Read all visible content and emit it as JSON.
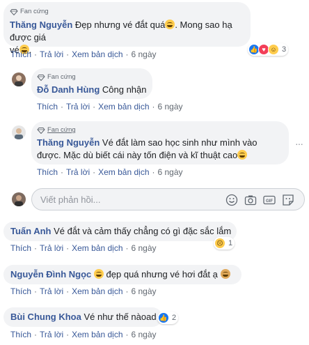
{
  "fan_badge": "Fan cứng",
  "actions": {
    "like": "Thích",
    "reply": "Trả lời",
    "translate": "Xem bản dịch",
    "time": "6 ngày",
    "sep": "·"
  },
  "comment1": {
    "name": "Thăng Nguyễn",
    "text_a": "Đẹp nhưng vé đắt quá",
    "text_b": ". Mong sao hạ được giá",
    "text_c": "vé",
    "text_d": ".",
    "reaction_count": "3"
  },
  "reply1": {
    "name": "Đỗ Danh Hùng",
    "text": "Công nhận"
  },
  "reply2": {
    "name": "Thăng Nguyễn",
    "text_a": "Vé đắt làm sao học sinh như mình vào",
    "text_b": "được. Mặc dù biết cái này tốn điện và kĩ thuật cao"
  },
  "reply_box": {
    "placeholder": "Viết phản hồi..."
  },
  "comment2": {
    "name": "Tuấn Anh",
    "text": "Vé đắt và cảm thấy chẳng có gì đặc sắc lắm",
    "reaction_count": "1"
  },
  "comment3": {
    "name": "Nguyễn Đình Ngọc",
    "text": "đẹp quá nhưng vé hơi đắt ạ"
  },
  "comment4": {
    "name": "Bùi Chung Khoa",
    "text": "Vé như thế nàoad",
    "reaction_count": "2"
  },
  "colors": {
    "link": "#385898",
    "bubble": "#f2f3f5",
    "meta": "#606770",
    "like_blue": "#1877f2",
    "love_red": "#f33e58"
  }
}
